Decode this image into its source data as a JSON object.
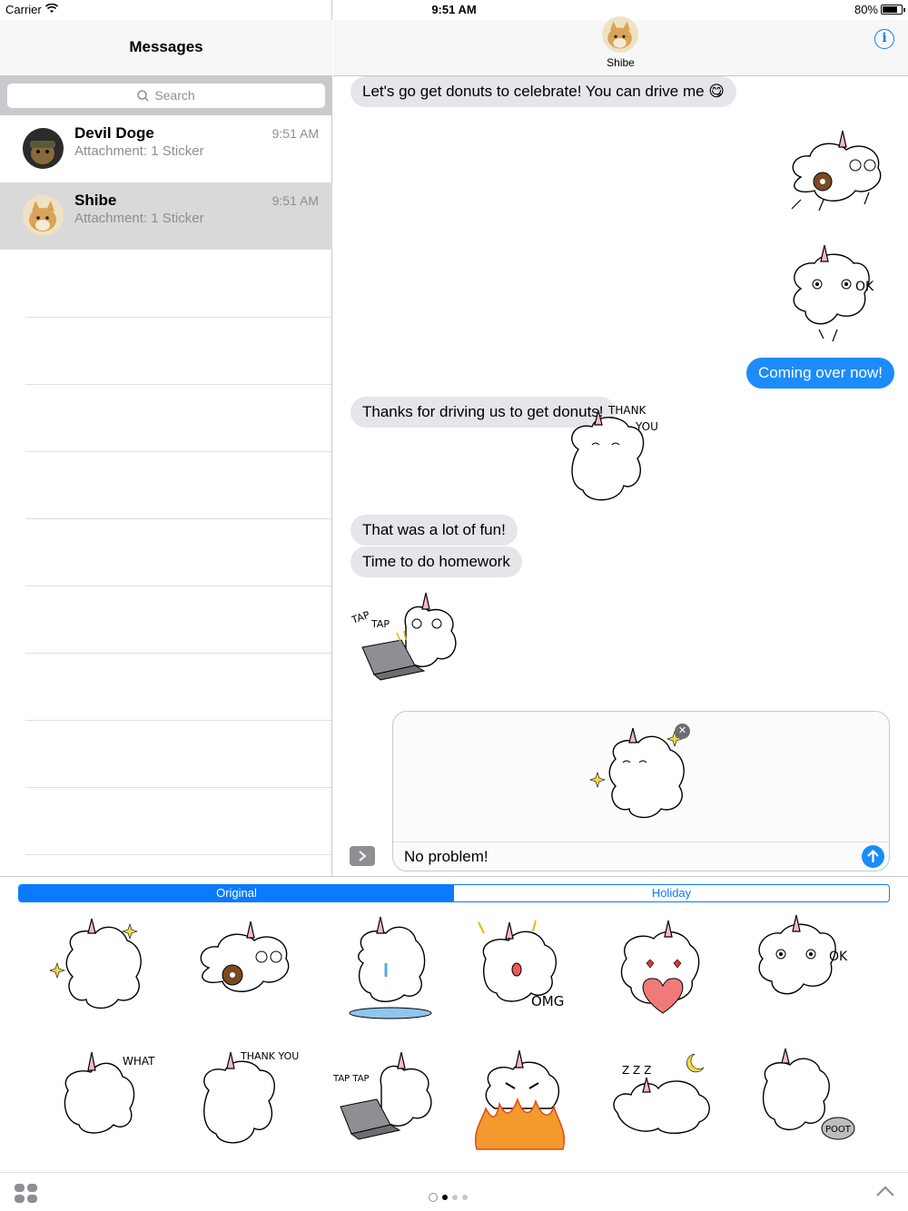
{
  "status_bar": {
    "carrier": "Carrier",
    "time": "9:51 AM",
    "battery": "80%",
    "battery_level": 0.8
  },
  "left_pane": {
    "title": "Messages",
    "search_placeholder": "Search",
    "conversations": [
      {
        "name": "Devil Doge",
        "snippet": "Attachment: 1 Sticker",
        "time": "9:51 AM",
        "selected": false
      },
      {
        "name": "Shibe",
        "snippet": "Attachment: 1 Sticker",
        "time": "9:51 AM",
        "selected": true
      }
    ]
  },
  "chat": {
    "contact_name": "Shibe",
    "messages": [
      {
        "dir": "in",
        "text": "Let's go get donuts to celebrate! You can drive me 😋"
      },
      {
        "dir": "out",
        "sticker": "unicorn-eating-donut-sticker"
      },
      {
        "dir": "out",
        "sticker": "unicorn-ok-sticker"
      },
      {
        "dir": "out",
        "text": "Coming over now!"
      },
      {
        "dir": "in",
        "text": "Thanks for driving us to get donuts!"
      },
      {
        "dir": "in",
        "sticker": "unicorn-thank-you-sticker",
        "sticker_text": [
          "THANK",
          "YOU"
        ]
      },
      {
        "dir": "in",
        "text": "That was a lot of fun!"
      },
      {
        "dir": "in",
        "text": "Time to do homework"
      },
      {
        "dir": "in",
        "sticker": "unicorn-typing-sticker",
        "sticker_text": [
          "TAP",
          "TAP"
        ]
      }
    ],
    "composer": {
      "text": "No problem!",
      "attached_sticker": "unicorn-sparkle-sticker"
    }
  },
  "sticker_drawer": {
    "tabs": [
      {
        "label": "Original",
        "active": true
      },
      {
        "label": "Holiday",
        "active": false
      }
    ],
    "stickers": [
      {
        "name": "sparkle",
        "text": ""
      },
      {
        "name": "donut",
        "text": ""
      },
      {
        "name": "crying",
        "text": ""
      },
      {
        "name": "omg",
        "text": "OMG"
      },
      {
        "name": "heart",
        "text": ""
      },
      {
        "name": "ok",
        "text": "OK"
      },
      {
        "name": "what",
        "text": "WHAT ?"
      },
      {
        "name": "thank-you",
        "text": "THANK YOU"
      },
      {
        "name": "tap-tap",
        "text": "TAP TAP"
      },
      {
        "name": "angry-fire",
        "text": ""
      },
      {
        "name": "sleeping",
        "text": "Z Z Z"
      },
      {
        "name": "poot",
        "text": "POOT"
      }
    ],
    "page_count": 3,
    "current_page": 1
  },
  "colors": {
    "accent": "#0a7aff",
    "outgoing_bubble": "#1b8cfa",
    "incoming_bubble": "#e5e5ea",
    "selected_row": "#d9d9d9"
  }
}
